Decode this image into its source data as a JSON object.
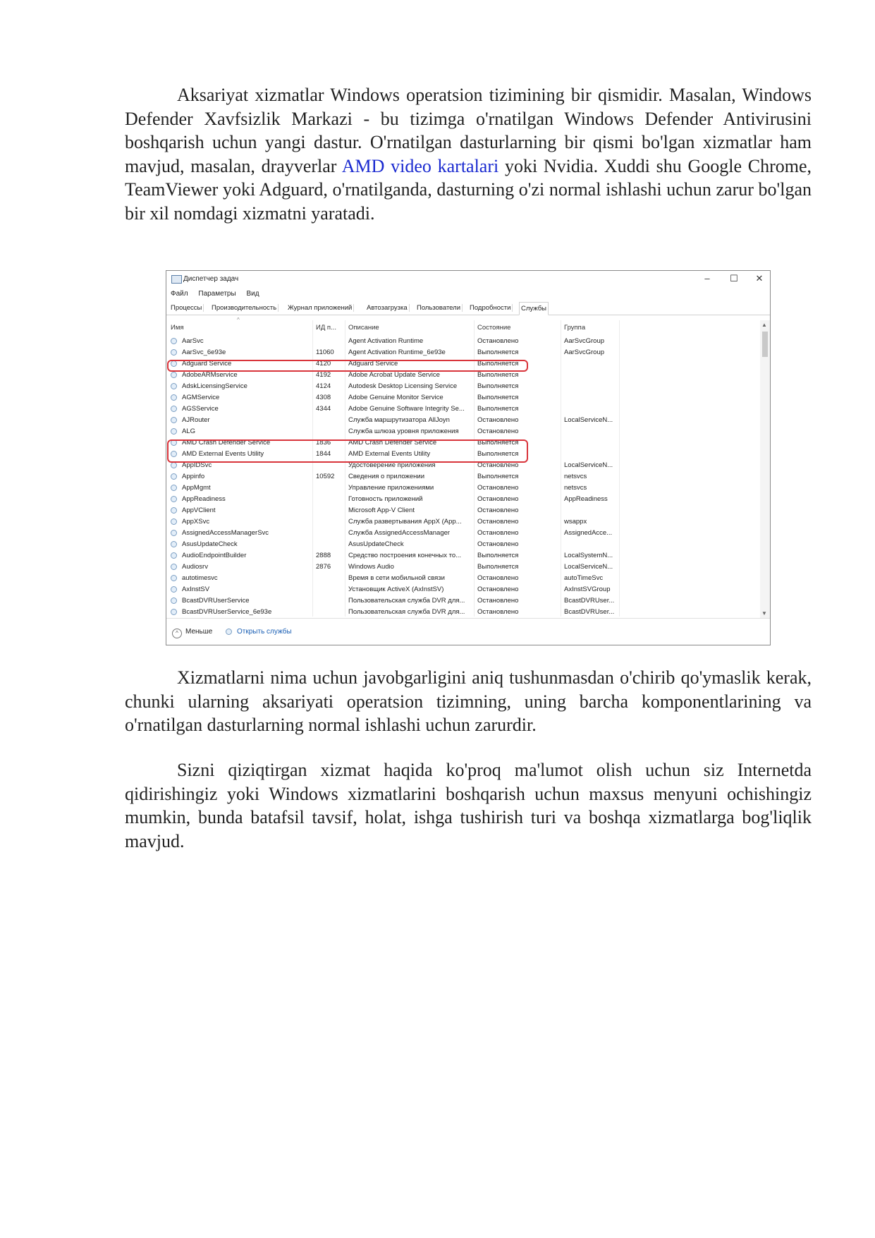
{
  "paragraph1": {
    "before_link": "Aksariyat xizmatlar Windows operatsion tizimining bir qismidir. Masalan, Windows Defender Xavfsizlik Markazi - bu tizimga o'rnatilgan Windows Defender Antivirusini boshqarish uchun yangi dastur. O'rnatilgan dasturlarning bir qismi bo'lgan xizmatlar ham mavjud, masalan, drayverlar ",
    "link": "AMD video kartalari",
    "after_link": " yoki Nvidia. Xuddi shu Google Chrome, TeamViewer yoki Adguard, o'rnatilganda, dasturning o'zi normal ishlashi uchun zarur bo'lgan bir xil nomdagi xizmatni yaratadi."
  },
  "screenshot": {
    "title": "Диспетчер задач",
    "window_buttons": [
      "–",
      "☐",
      "✕"
    ],
    "menu": [
      "Файл",
      "Параметры",
      "Вид"
    ],
    "tabs": [
      "Процессы",
      "Производительность",
      "Журнал приложений",
      "Автозагрузка",
      "Пользователи",
      "Подробности",
      "Службы"
    ],
    "columns": [
      "Имя",
      "ИД п...",
      "Описание",
      "Состояние",
      "Группа"
    ],
    "rows": [
      {
        "name": "AarSvc",
        "pid": "",
        "desc": "Agent Activation Runtime",
        "status": "Остановлено",
        "group": "AarSvcGroup"
      },
      {
        "name": "AarSvc_6e93e",
        "pid": "11060",
        "desc": "Agent Activation Runtime_6e93e",
        "status": "Выполняется",
        "group": "AarSvcGroup"
      },
      {
        "name": "Adguard Service",
        "pid": "4120",
        "desc": "Adguard Service",
        "status": "Выполняется",
        "group": ""
      },
      {
        "name": "AdobeARMservice",
        "pid": "4192",
        "desc": "Adobe Acrobat Update Service",
        "status": "Выполняется",
        "group": ""
      },
      {
        "name": "AdskLicensingService",
        "pid": "4124",
        "desc": "Autodesk Desktop Licensing Service",
        "status": "Выполняется",
        "group": ""
      },
      {
        "name": "AGMService",
        "pid": "4308",
        "desc": "Adobe Genuine Monitor Service",
        "status": "Выполняется",
        "group": ""
      },
      {
        "name": "AGSService",
        "pid": "4344",
        "desc": "Adobe Genuine Software Integrity Se...",
        "status": "Выполняется",
        "group": ""
      },
      {
        "name": "AJRouter",
        "pid": "",
        "desc": "Служба маршрутизатора AllJoyn",
        "status": "Остановлено",
        "group": "LocalServiceN..."
      },
      {
        "name": "ALG",
        "pid": "",
        "desc": "Служба шлюза уровня приложения",
        "status": "Остановлено",
        "group": ""
      },
      {
        "name": "AMD Crash Defender Service",
        "pid": "1836",
        "desc": "AMD Crash Defender Service",
        "status": "Выполняется",
        "group": ""
      },
      {
        "name": "AMD External Events Utility",
        "pid": "1844",
        "desc": "AMD External Events Utility",
        "status": "Выполняется",
        "group": ""
      },
      {
        "name": "AppIDSvc",
        "pid": "",
        "desc": "Удостоверение приложения",
        "status": "Остановлено",
        "group": "LocalServiceN..."
      },
      {
        "name": "Appinfo",
        "pid": "10592",
        "desc": "Сведения о приложении",
        "status": "Выполняется",
        "group": "netsvcs"
      },
      {
        "name": "AppMgmt",
        "pid": "",
        "desc": "Управление приложениями",
        "status": "Остановлено",
        "group": "netsvcs"
      },
      {
        "name": "AppReadiness",
        "pid": "",
        "desc": "Готовность приложений",
        "status": "Остановлено",
        "group": "AppReadiness"
      },
      {
        "name": "AppVClient",
        "pid": "",
        "desc": "Microsoft App-V Client",
        "status": "Остановлено",
        "group": ""
      },
      {
        "name": "AppXSvc",
        "pid": "",
        "desc": "Служба развертывания AppX (App...",
        "status": "Остановлено",
        "group": "wsappx"
      },
      {
        "name": "AssignedAccessManagerSvc",
        "pid": "",
        "desc": "Служба AssignedAccessManager",
        "status": "Остановлено",
        "group": "AssignedAcce..."
      },
      {
        "name": "AsusUpdateCheck",
        "pid": "",
        "desc": "AsusUpdateCheck",
        "status": "Остановлено",
        "group": ""
      },
      {
        "name": "AudioEndpointBuilder",
        "pid": "2888",
        "desc": "Средство построения конечных то...",
        "status": "Выполняется",
        "group": "LocalSystemN..."
      },
      {
        "name": "Audiosrv",
        "pid": "2876",
        "desc": "Windows Audio",
        "status": "Выполняется",
        "group": "LocalServiceN..."
      },
      {
        "name": "autotimesvc",
        "pid": "",
        "desc": "Время в сети мобильной связи",
        "status": "Остановлено",
        "group": "autoTimeSvc"
      },
      {
        "name": "AxInstSV",
        "pid": "",
        "desc": "Установщик ActiveX (AxInstSV)",
        "status": "Остановлено",
        "group": "AxInstSVGroup"
      },
      {
        "name": "BcastDVRUserService",
        "pid": "",
        "desc": "Пользовательская служба DVR для...",
        "status": "Остановлено",
        "group": "BcastDVRUser..."
      },
      {
        "name": "BcastDVRUserService_6e93e",
        "pid": "",
        "desc": "Пользовательская служба DVR для...",
        "status": "Остановлено",
        "group": "BcastDVRUser..."
      }
    ],
    "footer": {
      "fewer": "Меньше",
      "open_services": "Открыть службы"
    },
    "highlight_color": "#d9343b"
  },
  "paragraph2": "Xizmatlarni nima uchun javobgarligini aniq tushunmasdan o'chirib qo'ymaslik kerak, chunki ularning aksariyati operatsion tizimning, uning barcha komponentlarining va o'rnatilgan dasturlarning normal ishlashi uchun zarurdir.",
  "paragraph3": "Sizni qiziqtirgan xizmat haqida ko'proq ma'lumot olish uchun siz Internetda qidirishingiz yoki Windows xizmatlarini boshqarish uchun maxsus menyuni ochishingiz mumkin, bunda batafsil tavsif, holat, ishga tushirish turi va boshqa xizmatlarga bog'liqlik mavjud."
}
